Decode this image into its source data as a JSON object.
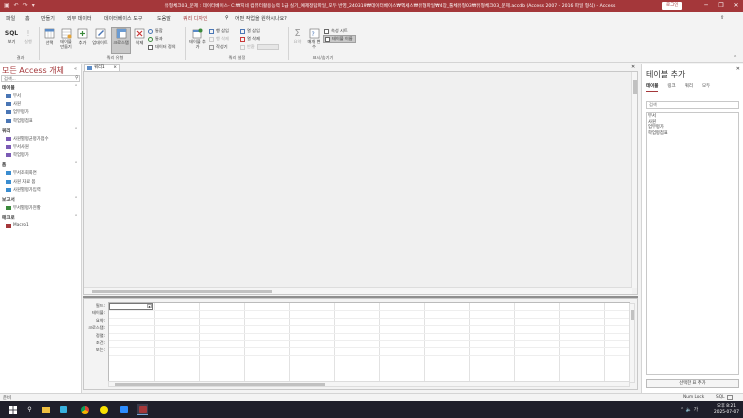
{
  "titlebar": {
    "title": "유형체크03_문제 : 데이터베이스- C:₩지네 컴퓨터활용능력 1급 실기_예제정답파일_모두 반영_240319₩데이터베이스₩엑세스₩유형파일₩4장_툴체유형03₩유형체크03_문제.accdb (Access 2007 - 2016 파일 형식) - Access",
    "signin": "로그인",
    "minimize": "─",
    "restore": "❐",
    "close": "✕"
  },
  "ribbon": {
    "tabs": [
      {
        "label": "파일"
      },
      {
        "label": "홈"
      },
      {
        "label": "만들기"
      },
      {
        "label": "외부 데이터"
      },
      {
        "label": "데이터베이스 도구"
      },
      {
        "label": "도움말"
      },
      {
        "label": "쿼리 디자인"
      },
      {
        "label": "어떤 작업을 원하시나요?"
      }
    ],
    "results": {
      "sql_label": "SQL",
      "view_label": "보기",
      "run_label": "실행",
      "group": "결과"
    },
    "query_type": {
      "select": "선택",
      "make_table": "테이블 만들기",
      "append": "추가",
      "update": "업데이트",
      "crosstab": "크로스탭",
      "delete": "삭제",
      "union": "통합",
      "passthrough": "통과",
      "data_definition": "데이터 정의",
      "group": "쿼리 유형"
    },
    "setup": {
      "add_tables": "테이블 추가",
      "builder": "작성기",
      "insert_rows": "행 삽입",
      "delete_rows": "행 삭제",
      "insert_cols": "열 삽입",
      "delete_cols": "열 삭제",
      "return": "반환",
      "group": "쿼리 설정"
    },
    "showhide": {
      "totals": "요약",
      "parameters": "매개 변수",
      "property_sheet": "속성 시트",
      "table_names": "테이블 이름",
      "group": "표시/숨기기"
    }
  },
  "nav": {
    "title": "모든 Access 개체",
    "search_placeholder": "검색...",
    "categories": [
      {
        "label": "테이블",
        "items": [
          "부서",
          "사원",
          "업무평가",
          "학업평점표"
        ]
      },
      {
        "label": "쿼리",
        "items": [
          "사원별평균평가점수",
          "부서사원",
          "학업평가"
        ]
      },
      {
        "label": "폼",
        "items": [
          "부서조회화면",
          "사원 자료 폼",
          "사원별평가입력"
        ]
      },
      {
        "label": "보고서",
        "items": [
          "부서별평가현황"
        ]
      },
      {
        "label": "매크로",
        "items": [
          "Macro1"
        ]
      }
    ]
  },
  "document": {
    "tab_label": "쿼리1",
    "grid_labels": [
      "필드:",
      "테이블:",
      "요약:",
      "크로스탭:",
      "정렬:",
      "조건:",
      "또는:"
    ]
  },
  "addpane": {
    "title": "테이블 추가",
    "tabs": [
      "테이블",
      "링크",
      "쿼리",
      "모두"
    ],
    "search_placeholder": "검색",
    "tables": [
      "부서",
      "사원",
      "업무평가",
      "학업평점표"
    ],
    "add_button": "선택한 표 추가"
  },
  "statusbar": {
    "status": "준비",
    "numlock": "Num Lock",
    "sql": "SQL"
  },
  "taskbar": {
    "time": "오후 8:21",
    "date": "2025-07-07",
    "tray_lang": "가"
  },
  "colors": {
    "access_accent": "#a4373a",
    "ribbon_bg": "#f3f3f3",
    "taskbar_bg": "#1f1f2b"
  }
}
